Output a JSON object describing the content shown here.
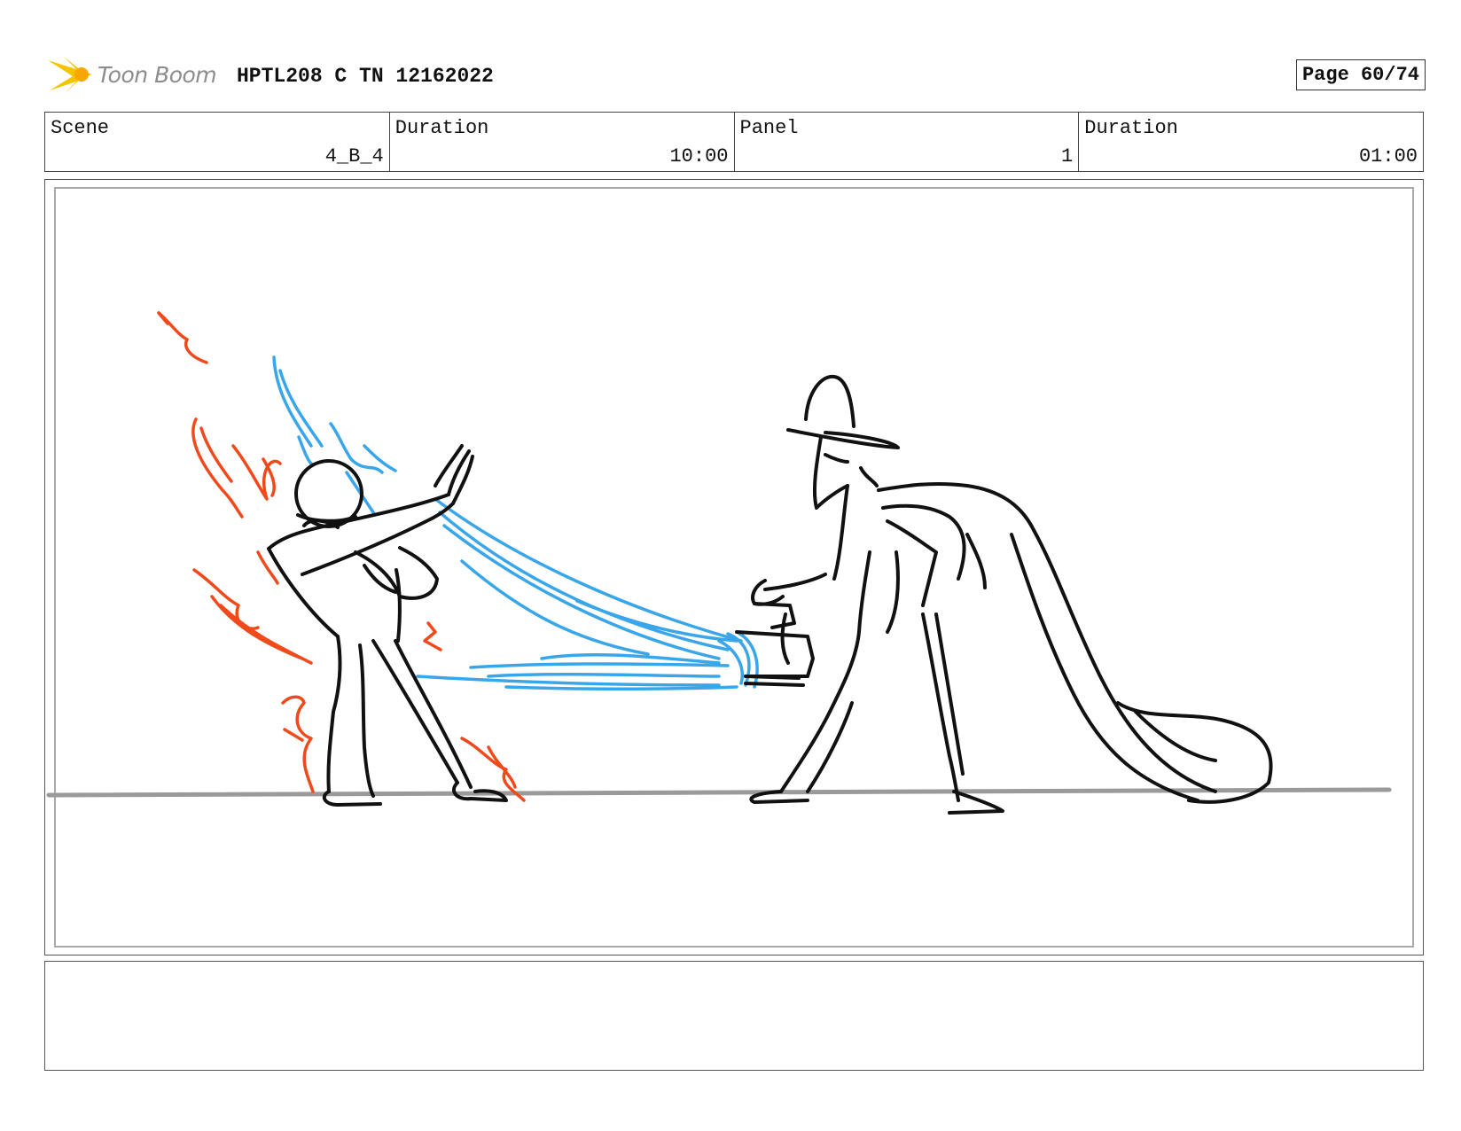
{
  "header": {
    "logo_text": "Toon Boom",
    "title": "HPTL208 C TN 12162022",
    "page_label": "Page 60/74"
  },
  "info": {
    "scene_label": "Scene",
    "scene_value": "4_B_4",
    "duration_label": "Duration",
    "duration_value": "10:00",
    "panel_label": "Panel",
    "panel_value": "1",
    "panel_duration_label": "Duration",
    "panel_duration_value": "01:00"
  },
  "colors": {
    "ink": "#111111",
    "water": "#3aa6ea",
    "fire": "#f04a1c",
    "ground": "#9a9a9a",
    "logo_burst": "#f5c400"
  },
  "notes": ""
}
